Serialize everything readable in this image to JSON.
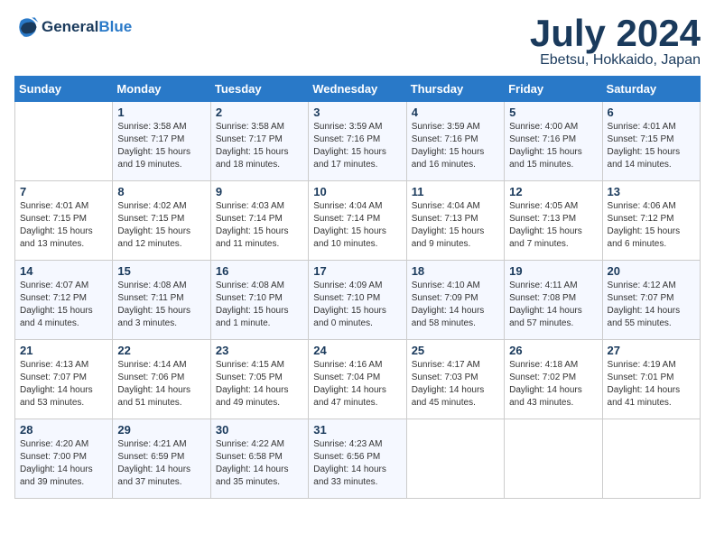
{
  "header": {
    "logo_line1": "General",
    "logo_line2": "Blue",
    "month_title": "July 2024",
    "location": "Ebetsu, Hokkaido, Japan"
  },
  "weekdays": [
    "Sunday",
    "Monday",
    "Tuesday",
    "Wednesday",
    "Thursday",
    "Friday",
    "Saturday"
  ],
  "weeks": [
    [
      {
        "day": "",
        "sunrise": "",
        "sunset": "",
        "daylight": ""
      },
      {
        "day": "1",
        "sunrise": "Sunrise: 3:58 AM",
        "sunset": "Sunset: 7:17 PM",
        "daylight": "Daylight: 15 hours and 19 minutes."
      },
      {
        "day": "2",
        "sunrise": "Sunrise: 3:58 AM",
        "sunset": "Sunset: 7:17 PM",
        "daylight": "Daylight: 15 hours and 18 minutes."
      },
      {
        "day": "3",
        "sunrise": "Sunrise: 3:59 AM",
        "sunset": "Sunset: 7:16 PM",
        "daylight": "Daylight: 15 hours and 17 minutes."
      },
      {
        "day": "4",
        "sunrise": "Sunrise: 3:59 AM",
        "sunset": "Sunset: 7:16 PM",
        "daylight": "Daylight: 15 hours and 16 minutes."
      },
      {
        "day": "5",
        "sunrise": "Sunrise: 4:00 AM",
        "sunset": "Sunset: 7:16 PM",
        "daylight": "Daylight: 15 hours and 15 minutes."
      },
      {
        "day": "6",
        "sunrise": "Sunrise: 4:01 AM",
        "sunset": "Sunset: 7:15 PM",
        "daylight": "Daylight: 15 hours and 14 minutes."
      }
    ],
    [
      {
        "day": "7",
        "sunrise": "Sunrise: 4:01 AM",
        "sunset": "Sunset: 7:15 PM",
        "daylight": "Daylight: 15 hours and 13 minutes."
      },
      {
        "day": "8",
        "sunrise": "Sunrise: 4:02 AM",
        "sunset": "Sunset: 7:15 PM",
        "daylight": "Daylight: 15 hours and 12 minutes."
      },
      {
        "day": "9",
        "sunrise": "Sunrise: 4:03 AM",
        "sunset": "Sunset: 7:14 PM",
        "daylight": "Daylight: 15 hours and 11 minutes."
      },
      {
        "day": "10",
        "sunrise": "Sunrise: 4:04 AM",
        "sunset": "Sunset: 7:14 PM",
        "daylight": "Daylight: 15 hours and 10 minutes."
      },
      {
        "day": "11",
        "sunrise": "Sunrise: 4:04 AM",
        "sunset": "Sunset: 7:13 PM",
        "daylight": "Daylight: 15 hours and 9 minutes."
      },
      {
        "day": "12",
        "sunrise": "Sunrise: 4:05 AM",
        "sunset": "Sunset: 7:13 PM",
        "daylight": "Daylight: 15 hours and 7 minutes."
      },
      {
        "day": "13",
        "sunrise": "Sunrise: 4:06 AM",
        "sunset": "Sunset: 7:12 PM",
        "daylight": "Daylight: 15 hours and 6 minutes."
      }
    ],
    [
      {
        "day": "14",
        "sunrise": "Sunrise: 4:07 AM",
        "sunset": "Sunset: 7:12 PM",
        "daylight": "Daylight: 15 hours and 4 minutes."
      },
      {
        "day": "15",
        "sunrise": "Sunrise: 4:08 AM",
        "sunset": "Sunset: 7:11 PM",
        "daylight": "Daylight: 15 hours and 3 minutes."
      },
      {
        "day": "16",
        "sunrise": "Sunrise: 4:08 AM",
        "sunset": "Sunset: 7:10 PM",
        "daylight": "Daylight: 15 hours and 1 minute."
      },
      {
        "day": "17",
        "sunrise": "Sunrise: 4:09 AM",
        "sunset": "Sunset: 7:10 PM",
        "daylight": "Daylight: 15 hours and 0 minutes."
      },
      {
        "day": "18",
        "sunrise": "Sunrise: 4:10 AM",
        "sunset": "Sunset: 7:09 PM",
        "daylight": "Daylight: 14 hours and 58 minutes."
      },
      {
        "day": "19",
        "sunrise": "Sunrise: 4:11 AM",
        "sunset": "Sunset: 7:08 PM",
        "daylight": "Daylight: 14 hours and 57 minutes."
      },
      {
        "day": "20",
        "sunrise": "Sunrise: 4:12 AM",
        "sunset": "Sunset: 7:07 PM",
        "daylight": "Daylight: 14 hours and 55 minutes."
      }
    ],
    [
      {
        "day": "21",
        "sunrise": "Sunrise: 4:13 AM",
        "sunset": "Sunset: 7:07 PM",
        "daylight": "Daylight: 14 hours and 53 minutes."
      },
      {
        "day": "22",
        "sunrise": "Sunrise: 4:14 AM",
        "sunset": "Sunset: 7:06 PM",
        "daylight": "Daylight: 14 hours and 51 minutes."
      },
      {
        "day": "23",
        "sunrise": "Sunrise: 4:15 AM",
        "sunset": "Sunset: 7:05 PM",
        "daylight": "Daylight: 14 hours and 49 minutes."
      },
      {
        "day": "24",
        "sunrise": "Sunrise: 4:16 AM",
        "sunset": "Sunset: 7:04 PM",
        "daylight": "Daylight: 14 hours and 47 minutes."
      },
      {
        "day": "25",
        "sunrise": "Sunrise: 4:17 AM",
        "sunset": "Sunset: 7:03 PM",
        "daylight": "Daylight: 14 hours and 45 minutes."
      },
      {
        "day": "26",
        "sunrise": "Sunrise: 4:18 AM",
        "sunset": "Sunset: 7:02 PM",
        "daylight": "Daylight: 14 hours and 43 minutes."
      },
      {
        "day": "27",
        "sunrise": "Sunrise: 4:19 AM",
        "sunset": "Sunset: 7:01 PM",
        "daylight": "Daylight: 14 hours and 41 minutes."
      }
    ],
    [
      {
        "day": "28",
        "sunrise": "Sunrise: 4:20 AM",
        "sunset": "Sunset: 7:00 PM",
        "daylight": "Daylight: 14 hours and 39 minutes."
      },
      {
        "day": "29",
        "sunrise": "Sunrise: 4:21 AM",
        "sunset": "Sunset: 6:59 PM",
        "daylight": "Daylight: 14 hours and 37 minutes."
      },
      {
        "day": "30",
        "sunrise": "Sunrise: 4:22 AM",
        "sunset": "Sunset: 6:58 PM",
        "daylight": "Daylight: 14 hours and 35 minutes."
      },
      {
        "day": "31",
        "sunrise": "Sunrise: 4:23 AM",
        "sunset": "Sunset: 6:56 PM",
        "daylight": "Daylight: 14 hours and 33 minutes."
      },
      {
        "day": "",
        "sunrise": "",
        "sunset": "",
        "daylight": ""
      },
      {
        "day": "",
        "sunrise": "",
        "sunset": "",
        "daylight": ""
      },
      {
        "day": "",
        "sunrise": "",
        "sunset": "",
        "daylight": ""
      }
    ]
  ]
}
